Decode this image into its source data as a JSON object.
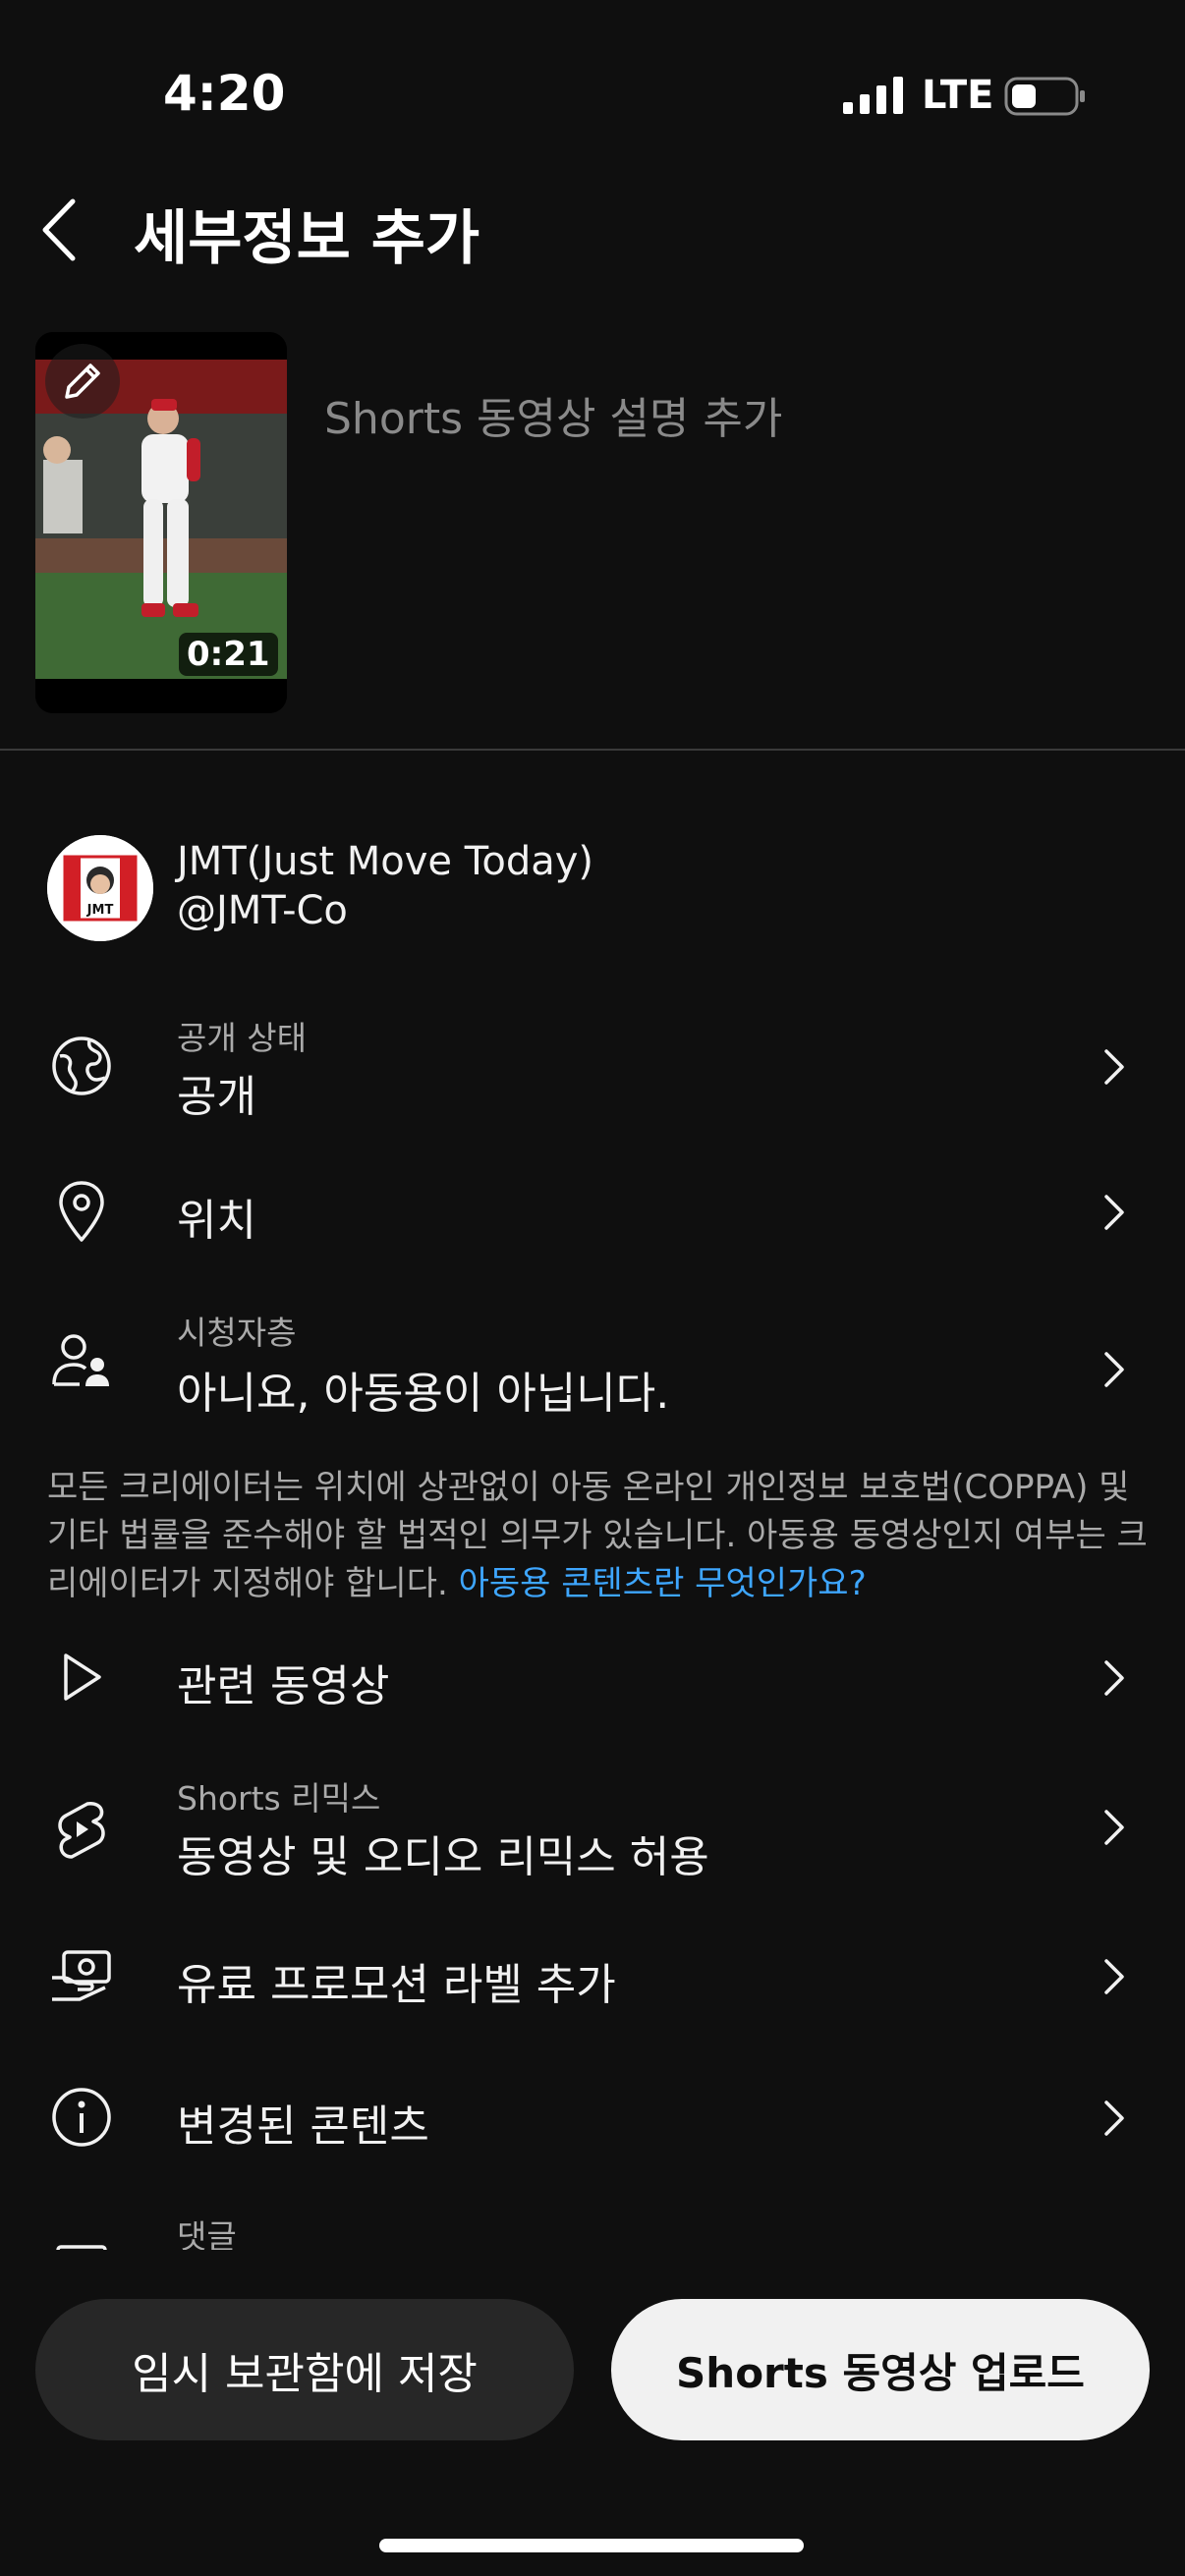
{
  "status_bar": {
    "time": "4:20",
    "network": "LTE"
  },
  "header": {
    "title": "세부정보 추가"
  },
  "video": {
    "duration": "0:21",
    "description_placeholder": "Shorts 동영상 설명 추가"
  },
  "channel": {
    "name": "JMT(Just Move Today)",
    "handle": "@JMT-Co",
    "avatar_text": "JMT"
  },
  "visibility": {
    "label": "공개 상태",
    "value": "공개"
  },
  "location": {
    "label": "위치"
  },
  "audience": {
    "label": "시청자층",
    "value": "아니요, 아동용이 아닙니다."
  },
  "notice": {
    "text": "모든 크리에이터는 위치에 상관없이 아동 온라인 개인정보 보호법(COPPA) 및 기타 법률을 준수해야 할 법적인 의무가 있습니다. 아동용 동영상인지 여부는 크리에이터가 지정해야 합니다. ",
    "link": "아동용 콘텐츠란 무엇인가요?"
  },
  "related_video": {
    "label": "관련 동영상"
  },
  "remix": {
    "label": "Shorts 리믹스",
    "value": "동영상 및 오디오 리믹스 허용"
  },
  "paid_promo": {
    "label": "유료 프로모션 라벨 추가"
  },
  "altered_content": {
    "label": "변경된 콘텐츠"
  },
  "comments": {
    "label": "댓글"
  },
  "actions": {
    "draft_label": "임시 보관함에 저장",
    "upload_label": "Shorts 동영상 업로드"
  },
  "colors": {
    "background": "#0f0f0f",
    "link": "#3ea6ff",
    "primary_button": "#f1f1f1",
    "secondary_button": "#272727"
  }
}
